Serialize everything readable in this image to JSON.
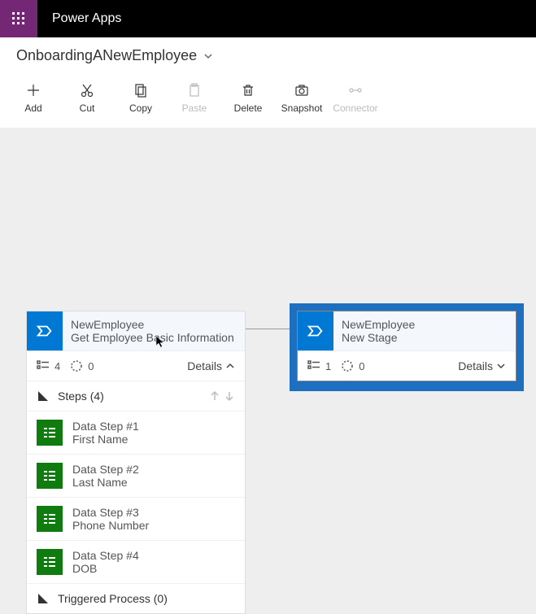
{
  "app_title": "Power Apps",
  "breadcrumb": "OnboardingANewEmployee",
  "toolbar": {
    "add": "Add",
    "cut": "Cut",
    "copy": "Copy",
    "paste": "Paste",
    "delete": "Delete",
    "snapshot": "Snapshot",
    "connector": "Connector"
  },
  "stage_left": {
    "title1": "NewEmployee",
    "title2": "Get Employee Basic Information",
    "stat1": "4",
    "stat2": "0",
    "details": "Details",
    "steps_header": "Steps (4)",
    "steps": [
      {
        "name": "Data Step #1",
        "field": "First Name"
      },
      {
        "name": "Data Step #2",
        "field": "Last Name"
      },
      {
        "name": "Data Step #3",
        "field": "Phone Number"
      },
      {
        "name": "Data Step #4",
        "field": "DOB"
      }
    ],
    "triggered": "Triggered Process (0)"
  },
  "stage_right": {
    "title1": "NewEmployee",
    "title2": "New Stage",
    "stat1": "1",
    "stat2": "0",
    "details": "Details"
  }
}
